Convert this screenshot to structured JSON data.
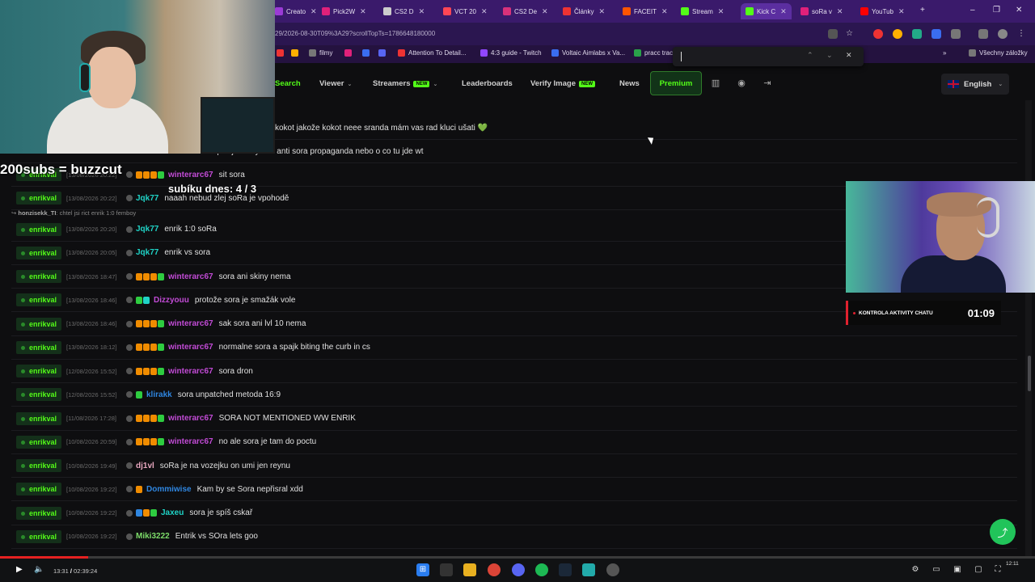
{
  "browser": {
    "tabs": [
      {
        "label": "Creato",
        "color": "#9b3bd6"
      },
      {
        "label": "Pick2W",
        "color": "#e0217a"
      },
      {
        "label": "CS2 D",
        "color": "#cccccc"
      },
      {
        "label": "VCT 20",
        "color": "#ff4655"
      },
      {
        "label": "CS2 De",
        "color": "#d8327a"
      },
      {
        "label": "Články",
        "color": "#e33"
      },
      {
        "label": "FACEIT",
        "color": "#ff5500"
      },
      {
        "label": "Stream",
        "color": "#53fc18"
      },
      {
        "label": "Kick C",
        "color": "#53fc18"
      },
      {
        "label": "soRa v",
        "color": "#e0217a"
      },
      {
        "label": "YouTub",
        "color": "#ff0000"
      }
    ],
    "new_tab": "+",
    "window_controls": [
      "–",
      "❐",
      "✕"
    ],
    "url": "29/2026-08-30T09%3A29?scrollTopTs=1786648180000",
    "bookmarks": [
      {
        "label": "",
        "color": "#e33"
      },
      {
        "label": "",
        "color": "#ffb000"
      },
      {
        "label": "filmy",
        "color": "#777"
      },
      {
        "label": "",
        "color": "#e0217a"
      },
      {
        "label": "",
        "color": "#3a6df0"
      },
      {
        "label": "",
        "color": "#5865f2"
      },
      {
        "label": "Attention To Detail...",
        "color": "#e33"
      },
      {
        "label": "4:3 guide - Twitch",
        "color": "#9146ff"
      },
      {
        "label": "Voltaic Aimlabs x Va...",
        "color": "#3a6df0"
      },
      {
        "label": "pracc trac",
        "color": "#2aa14a"
      },
      {
        "label": "Všechny záložky",
        "color": "#777"
      }
    ]
  },
  "nav": {
    "search": "Search",
    "viewer": "Viewer",
    "streamers": "Streamers",
    "new_badge": "NEW",
    "leaderboards": "Leaderboards",
    "verify_image": "Verify Image",
    "news": "News",
    "premium": "Premium",
    "language": "English"
  },
  "overlay": {
    "subs_goal": "200subs = buzzcut",
    "subs_today": "subíku dnes: 4 / 3",
    "timer_label": "KONTROLA AKTIVITY CHATU",
    "timer_value": "01:09"
  },
  "chat_partial": [
    {
      "msg": "kokot jakože kokot neee sranda mám vas rad kluci ušati 💚"
    },
    {
      "msg": "sq se jedsvuy asá anti sora propaganda nebo o co tu jde wt"
    }
  ],
  "chat": [
    {
      "channel": "enrikval",
      "time": "[13/08/2026 20:22]",
      "user": "winterarc67",
      "ucolor": "#c24bd6",
      "msg": "sit sora",
      "badges": [
        "#f08c00",
        "#f08c00",
        "#f08c00",
        "#2ecc40"
      ]
    },
    {
      "channel": "enrikval",
      "time": "[13/08/2026 20:22]",
      "user": "Jqk77",
      "ucolor": "#1fd3c6",
      "msg": "naaah nebud zlej soRa je vpohodě",
      "badges": []
    },
    {
      "channel": "enrikval",
      "time": "[13/08/2026 20:20]",
      "user": "Jqk77",
      "ucolor": "#1fd3c6",
      "msg": "enrik 1:0 soRa",
      "badges": []
    },
    {
      "channel": "enrikval",
      "time": "[13/08/2026 20:05]",
      "user": "Jqk77",
      "ucolor": "#1fd3c6",
      "msg": "enrik vs sora",
      "badges": []
    },
    {
      "channel": "enrikval",
      "time": "[13/08/2026 18:47]",
      "user": "winterarc67",
      "ucolor": "#c24bd6",
      "msg": "sora ani skiny nema",
      "badges": [
        "#f08c00",
        "#f08c00",
        "#f08c00",
        "#2ecc40"
      ]
    },
    {
      "channel": "enrikval",
      "time": "[13/08/2026 18:46]",
      "user": "Dizzyouu",
      "ucolor": "#c24bd6",
      "msg": "protože sora je smažák vole",
      "badges": [
        "#2ecc40",
        "#1fd3c6"
      ]
    },
    {
      "channel": "enrikval",
      "time": "[13/08/2026 18:46]",
      "user": "winterarc67",
      "ucolor": "#c24bd6",
      "msg": "sak sora ani lvl 10 nema",
      "badges": [
        "#f08c00",
        "#f08c00",
        "#f08c00",
        "#2ecc40"
      ]
    },
    {
      "channel": "enrikval",
      "time": "[13/08/2026 18:12]",
      "user": "winterarc67",
      "ucolor": "#c24bd6",
      "msg": "normalne sora a spajk biting the curb in cs",
      "badges": [
        "#f08c00",
        "#f08c00",
        "#f08c00",
        "#2ecc40"
      ]
    },
    {
      "channel": "enrikval",
      "time": "[12/08/2026 15:52]",
      "user": "winterarc67",
      "ucolor": "#c24bd6",
      "msg": "sora dron",
      "badges": [
        "#f08c00",
        "#f08c00",
        "#f08c00",
        "#2ecc40"
      ]
    },
    {
      "channel": "enrikval",
      "time": "[12/08/2026 15:52]",
      "user": "klirakk",
      "ucolor": "#2f86e0",
      "msg": "sora unpatched metoda 16:9",
      "badges": [
        "#2ecc40"
      ]
    },
    {
      "channel": "enrikval",
      "time": "[11/08/2026 17:28]",
      "user": "winterarc67",
      "ucolor": "#c24bd6",
      "msg": "SORA NOT MENTIONED WW ENRIK",
      "badges": [
        "#f08c00",
        "#f08c00",
        "#f08c00",
        "#2ecc40"
      ]
    },
    {
      "channel": "enrikval",
      "time": "[10/08/2026 20:59]",
      "user": "winterarc67",
      "ucolor": "#c24bd6",
      "msg": "no ale sora je tam do poctu",
      "badges": [
        "#f08c00",
        "#f08c00",
        "#f08c00",
        "#2ecc40"
      ]
    },
    {
      "channel": "enrikval",
      "time": "[10/08/2026 19:49]",
      "user": "dj1vl",
      "ucolor": "#e8a8c0",
      "msg": "soRa je na vozejku on umi jen reynu",
      "badges": []
    },
    {
      "channel": "enrikval",
      "time": "[10/08/2026 19:22]",
      "user": "Dommiwise",
      "ucolor": "#2f86e0",
      "msg": "Kam by se Sora nepřisral xdd",
      "badges": [
        "#f08c00"
      ]
    },
    {
      "channel": "enrikval",
      "time": "[10/08/2026 19:22]",
      "user": "Jaxeu",
      "ucolor": "#1fd3c6",
      "msg": "sora je spíš cskař",
      "badges": [
        "#2f86e0",
        "#f08c00",
        "#2ecc40"
      ]
    },
    {
      "channel": "enrikval",
      "time": "[10/08/2026 19:22]",
      "user": "Miki3222",
      "ucolor": "#7ddc6a",
      "msg": "Entrik vs SOra lets goo",
      "badges": []
    }
  ],
  "reply": {
    "user": "honzisekk_TI",
    "text": "chtel jsi rict enrik 1:0 femboy"
  },
  "player": {
    "current": "13:31",
    "total": "02:39:24",
    "progress": 0.085
  },
  "taskbar": {
    "clock": "12:11",
    "date": ""
  }
}
